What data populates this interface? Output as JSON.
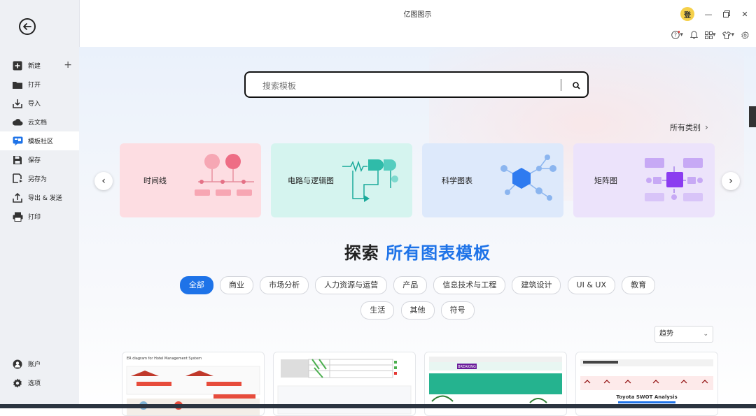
{
  "app": {
    "title": "亿图图示",
    "avatar_text": "登"
  },
  "sidebar": {
    "items": [
      {
        "label": "新建",
        "icon": "plus-square-icon"
      },
      {
        "label": "打开",
        "icon": "folder-icon"
      },
      {
        "label": "导入",
        "icon": "import-icon"
      },
      {
        "label": "云文档",
        "icon": "cloud-icon"
      },
      {
        "label": "模板社区",
        "icon": "template-community-icon"
      },
      {
        "label": "保存",
        "icon": "save-icon"
      },
      {
        "label": "另存为",
        "icon": "save-as-icon"
      },
      {
        "label": "导出 & 发送",
        "icon": "export-icon"
      },
      {
        "label": "打印",
        "icon": "print-icon"
      }
    ],
    "bottom": [
      {
        "label": "账户",
        "icon": "account-icon"
      },
      {
        "label": "选项",
        "icon": "gear-icon"
      }
    ]
  },
  "search": {
    "placeholder": "搜索模板"
  },
  "all_categories": "所有类别",
  "categories": [
    {
      "label": "时间线",
      "color": "#fddde2"
    },
    {
      "label": "电路与逻辑图",
      "color": "#d5f4ef"
    },
    {
      "label": "科学图表",
      "color": "#dde9fb"
    },
    {
      "label": "矩阵图",
      "color": "#ece3fb"
    }
  ],
  "heading": {
    "prefix": "探索",
    "highlight": "所有图表模板"
  },
  "filters_row1": [
    "全部",
    "商业",
    "市场分析",
    "人力资源与运营",
    "产品",
    "信息技术与工程",
    "建筑设计",
    "UI & UX",
    "教育"
  ],
  "filters_row2": [
    "生活",
    "其他",
    "符号"
  ],
  "sort": {
    "value": "趋势"
  },
  "templates": [
    {
      "caption": "ER diagram for Hotel Management System"
    },
    {
      "caption": ""
    },
    {
      "caption": "BREAKING"
    },
    {
      "caption": "Toyota SWOT Analysis"
    }
  ],
  "colors": {
    "accent": "#1e73e8",
    "sidebar_bg": "#eef0f4"
  }
}
